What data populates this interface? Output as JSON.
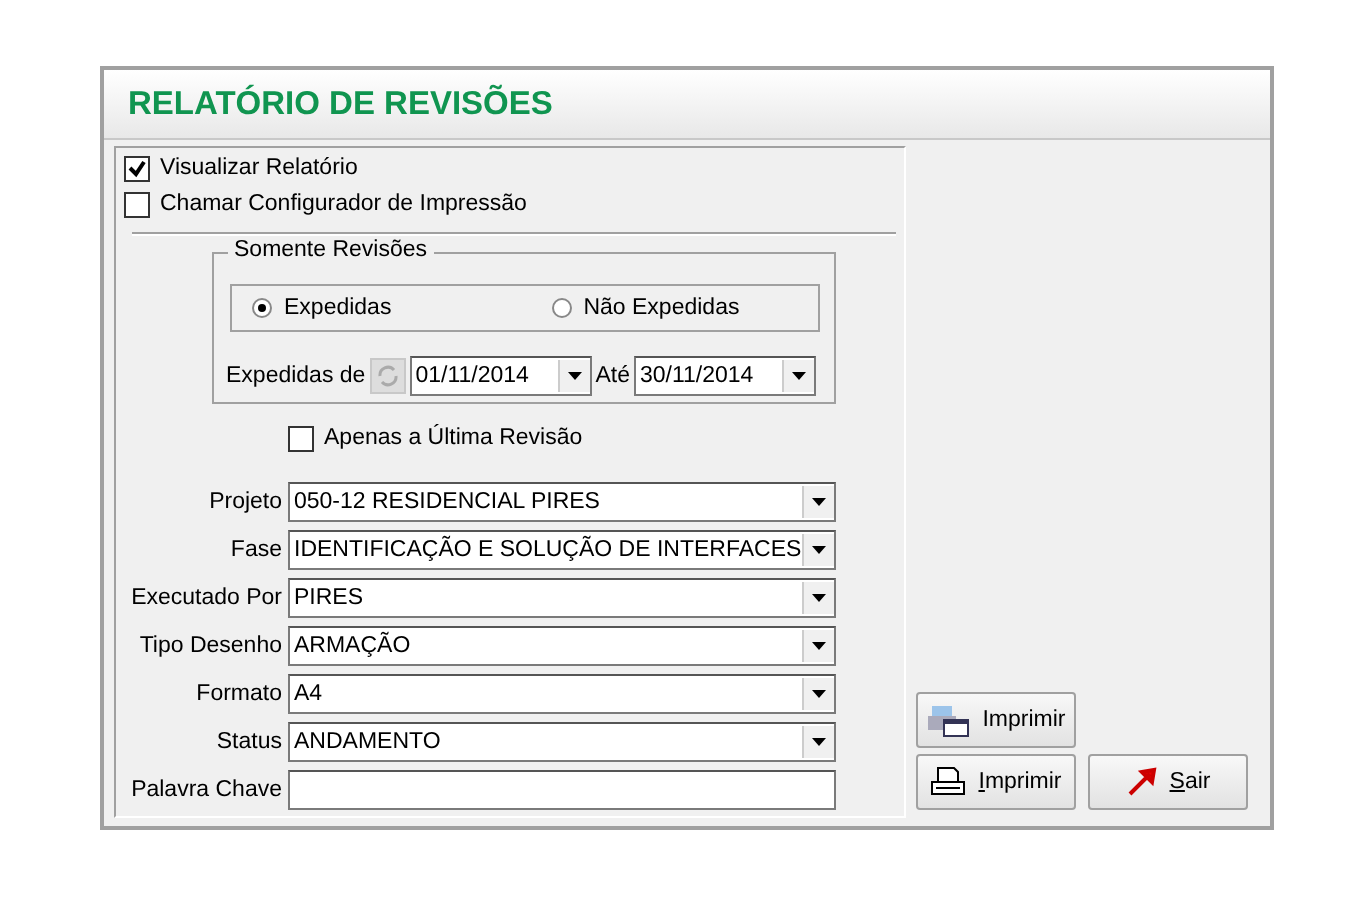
{
  "title": "RELATÓRIO DE REVISÕES",
  "options": [
    {
      "label": "Visualizar Relatório",
      "checked": true
    },
    {
      "label": "Chamar Configurador de Impressão",
      "checked": false
    }
  ],
  "group": {
    "title": "Somente Revisões",
    "radios": [
      {
        "label": "Expedidas",
        "selected": true
      },
      {
        "label": "Não Expedidas",
        "selected": false
      }
    ],
    "from_label": "Expedidas de",
    "from_date": "01/11/2014",
    "to_label": "Até",
    "to_date": "30/11/2014"
  },
  "last_revision": {
    "label": "Apenas a Última Revisão",
    "checked": false
  },
  "fields": [
    {
      "label": "Projeto",
      "kind": "combo",
      "value": "050-12 RESIDENCIAL PIRES"
    },
    {
      "label": "Fase",
      "kind": "combo",
      "value": "IDENTIFICAÇÃO E SOLUÇÃO DE INTERFACES"
    },
    {
      "label": "Executado Por",
      "kind": "combo",
      "value": "PIRES"
    },
    {
      "label": "Tipo Desenho",
      "kind": "combo",
      "value": "ARMAÇÃO"
    },
    {
      "label": "Formato",
      "kind": "combo",
      "value": "A4"
    },
    {
      "label": "Status",
      "kind": "combo",
      "value": "ANDAMENTO"
    },
    {
      "label": "Palavra Chave",
      "kind": "text"
    }
  ],
  "buttons": [
    {
      "label": "Imprimir",
      "kind": "preview"
    },
    {
      "label": "Imprimir",
      "kind": "print"
    },
    {
      "label": "Sair",
      "kind": "exit"
    }
  ]
}
